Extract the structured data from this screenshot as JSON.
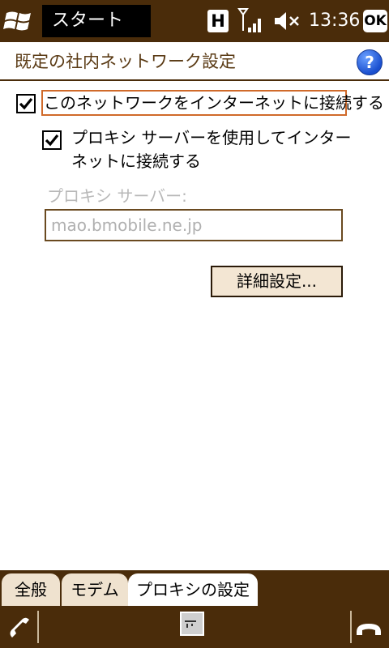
{
  "topbar": {
    "app_title": "スタート",
    "network_badge": "H",
    "time": "13:36",
    "ok_label": "OK",
    "icons": [
      "windows-start-icon",
      "signal-icon",
      "volume-muted-icon"
    ]
  },
  "header": {
    "title": "既定の社内ネットワーク設定",
    "help_label": "?"
  },
  "options": {
    "connect_internet": {
      "label": "このネットワークをインターネットに接続する",
      "checked": true
    },
    "use_proxy": {
      "label": "プロキシ サーバーを使用してインターネットに接続する",
      "checked": true
    }
  },
  "proxy_server": {
    "label": "プロキシ サーバー:",
    "value": "mao.bmobile.ne.jp"
  },
  "advanced_button": "詳細設定...",
  "tabs": [
    {
      "label": "全般",
      "active": false
    },
    {
      "label": "モデム",
      "active": false
    },
    {
      "label": "プロキシの設定",
      "active": true
    }
  ],
  "colors": {
    "bar": "#4a2c0a",
    "title_text": "#5a3a14",
    "focus_outline": "#d06a2a",
    "disabled_text": "#b8b8b8"
  }
}
